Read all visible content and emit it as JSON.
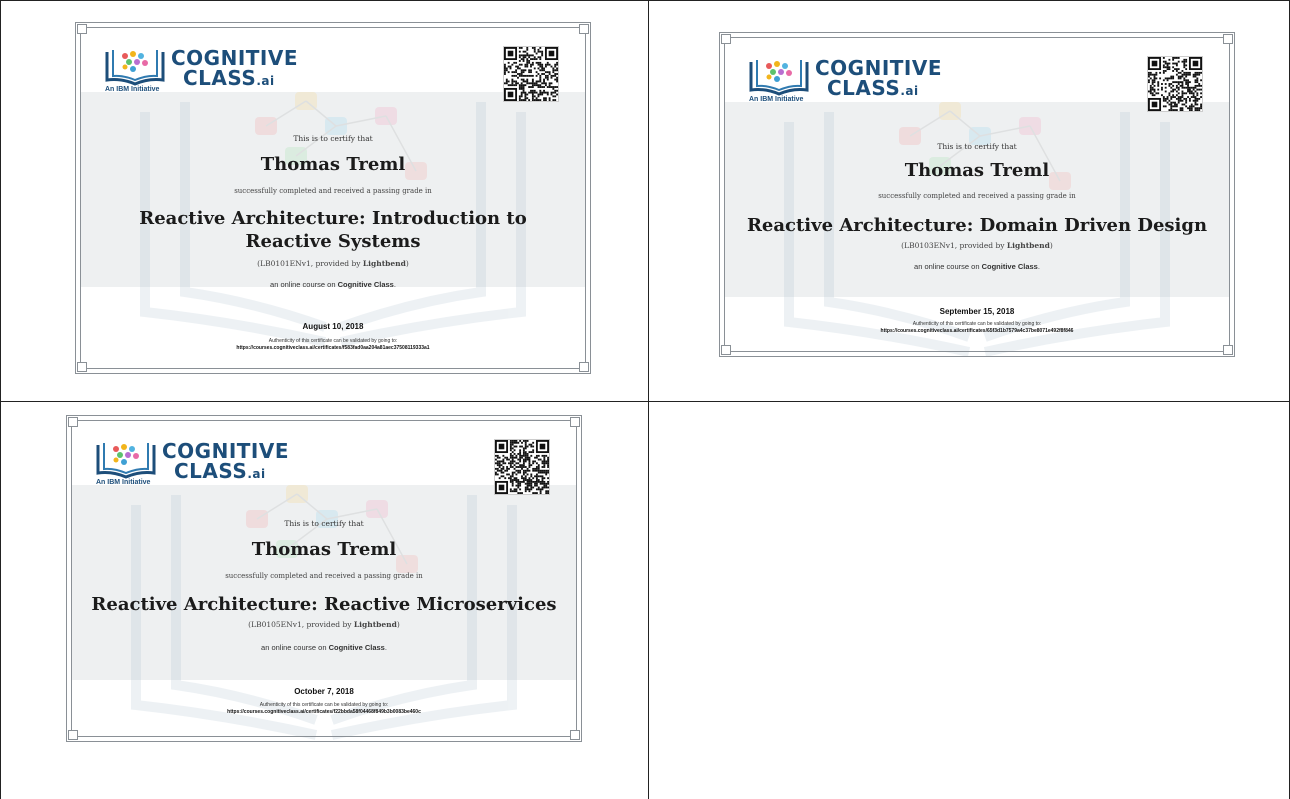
{
  "logo": {
    "line1": "COGNITIVE",
    "line2": "CLASS",
    "suffix": ".ai",
    "tagline": "An IBM Initiative"
  },
  "colors": {
    "brand": "#1d4e7a",
    "frame": "#8a9096",
    "band": "#eef0f1"
  },
  "icons": [
    "logo-book-icon",
    "qr-code-icon"
  ],
  "certificates": [
    {
      "certify_text": "This is to certify that",
      "name": "Thomas Treml",
      "passing_text": "successfully completed and received a passing grade in",
      "course_line1": "Reactive Architecture: Introduction to",
      "course_line2": "Reactive Systems",
      "course_id_prefix": "(LB0101ENv1, provided by ",
      "provider": "Lightbend",
      "course_id_suffix": ")",
      "online_prefix": "an online course on ",
      "online_org": "Cognitive Class",
      "online_suffix": ".",
      "date": "August 10, 2018",
      "auth_text": "Authenticity of this certificate can be validated by going to:",
      "url": "https://courses.cognitiveclass.ai/certificates/f583fad0aa204a81aec37508119333a1"
    },
    {
      "certify_text": "This is to certify that",
      "name": "Thomas Treml",
      "passing_text": "successfully completed and received a passing grade in",
      "course_line1": "Reactive Architecture: Domain Driven Design",
      "course_line2": "",
      "course_id_prefix": "(LB0103ENv1, provided by ",
      "provider": "Lightbend",
      "course_id_suffix": ")",
      "online_prefix": "an online course on ",
      "online_org": "Cognitive Class",
      "online_suffix": ".",
      "date": "September 15, 2018",
      "auth_text": "Authenticity of this certificate can be validated by going to:",
      "url": "https://courses.cognitiveclass.ai/certificates/65f3d1b7579a4c37be8071e492f8f846"
    },
    {
      "certify_text": "This is to certify that",
      "name": "Thomas Treml",
      "passing_text": "successfully completed and received a passing grade in",
      "course_line1": "Reactive Architecture: Reactive Microservices",
      "course_line2": "",
      "course_id_prefix": "(LB0105ENv1, provided by ",
      "provider": "Lightbend",
      "course_id_suffix": ")",
      "online_prefix": "an online course on ",
      "online_org": "Cognitive Class",
      "online_suffix": ".",
      "date": "October 7, 2018",
      "auth_text": "Authenticity of this certificate can be validated by going to:",
      "url": "https://courses.cognitiveclass.ai/certificates/f22bbda58f04468f849b3b0083be460c"
    }
  ]
}
